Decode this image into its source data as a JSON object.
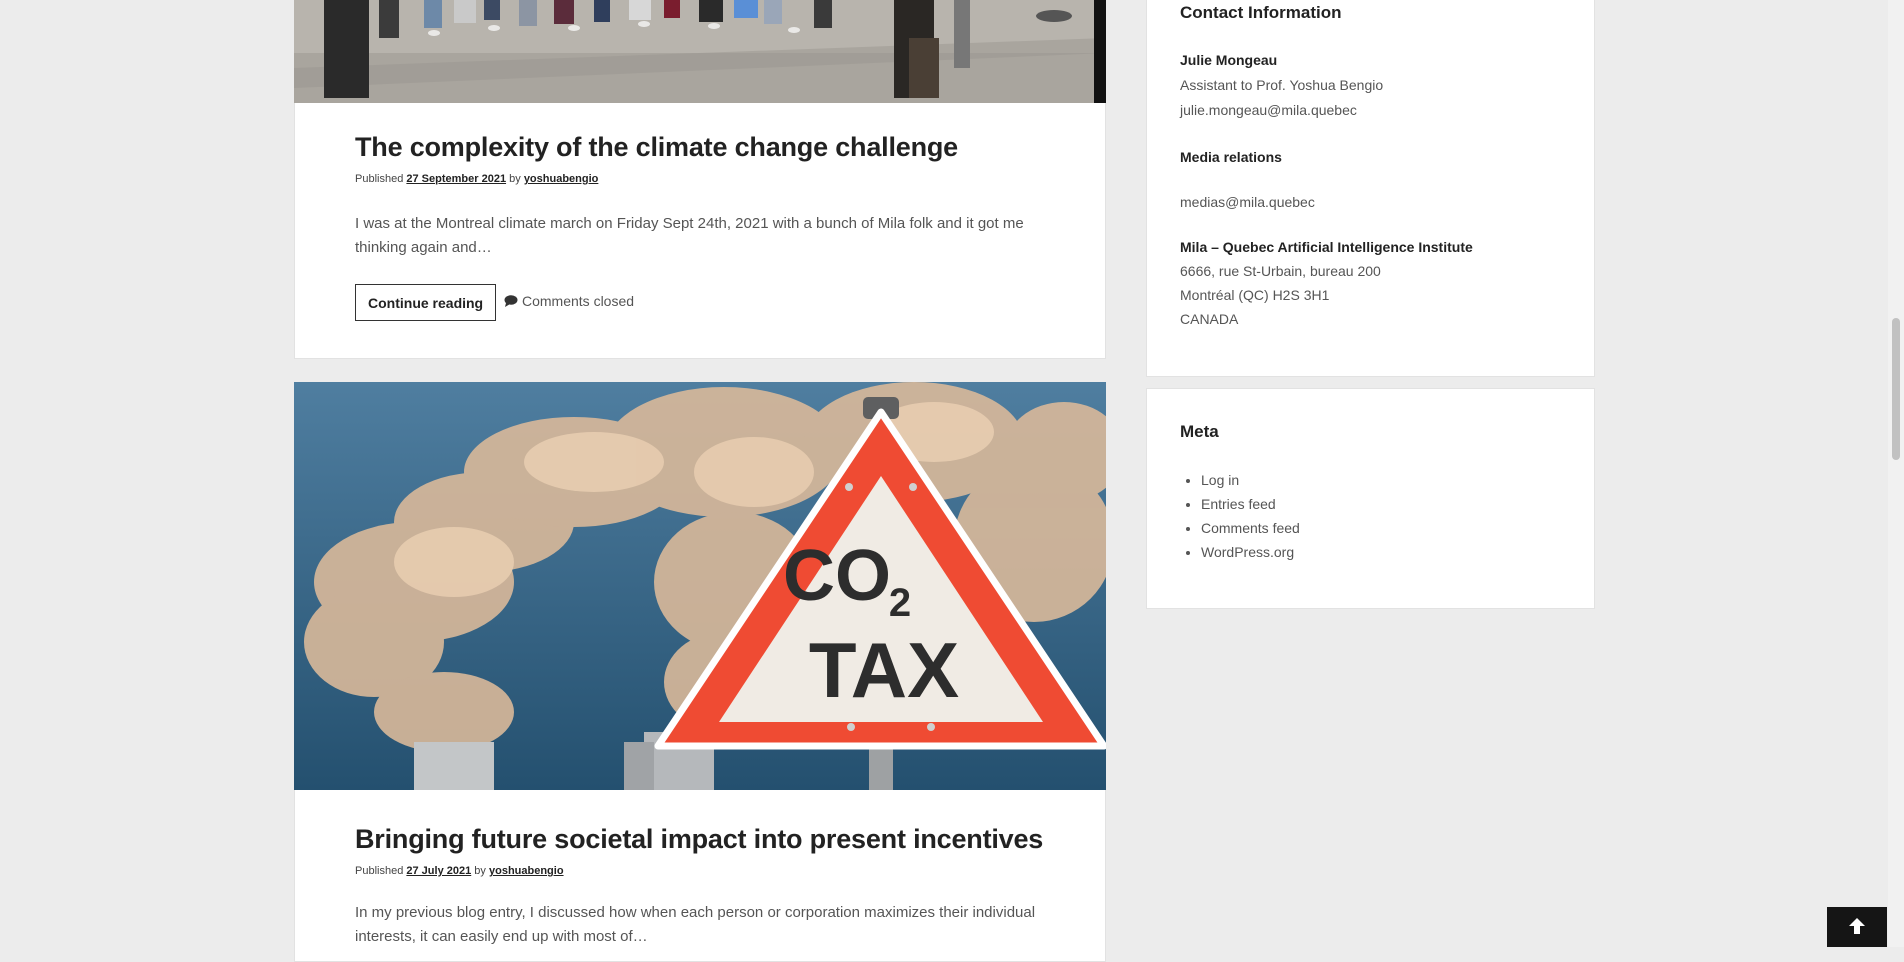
{
  "posts": [
    {
      "title": "The complexity of the climate change challenge",
      "published_label": "Published",
      "date": "27 September 2021",
      "by_label": "by",
      "author": "yoshuabengio",
      "excerpt": "I was at the Montreal climate march on Friday Sept 24th, 2021 with a bunch of Mila folk and it got me thinking again and…",
      "continue_label": "Continue reading",
      "comments_label": "Comments closed"
    },
    {
      "title": "Bringing future societal impact into present incentives",
      "published_label": "Published",
      "date": "27 July 2021",
      "by_label": "by",
      "author": "yoshuabengio",
      "excerpt": "In my previous blog entry, I discussed how when each person or corporation maximizes their individual interests, it can easily end up with most of…",
      "image_sign_line1": "CO",
      "image_sign_sub": "2",
      "image_sign_line2": "TAX"
    }
  ],
  "sidebar": {
    "contact": {
      "title": "Contact Information",
      "name": "Julie Mongeau",
      "role": "Assistant to Prof. Yoshua Bengio",
      "email": "julie.mongeau@mila.quebec",
      "media_title": "Media relations",
      "media_email": "medias@mila.quebec",
      "org": "Mila – Quebec Artificial Intelligence Institute",
      "address1": "6666, rue St-Urbain, bureau 200",
      "address2": "Montréal (QC) H2S 3H1",
      "country": "CANADA"
    },
    "meta": {
      "title": "Meta",
      "links": [
        "Log in",
        "Entries feed",
        "Comments feed",
        "WordPress.org"
      ]
    }
  },
  "icons": {
    "comment": "speech-bubble-icon",
    "back_to_top": "arrow-up-icon"
  },
  "colors": {
    "background": "#ececec",
    "card": "#ffffff",
    "sign_red": "#ef4b33",
    "back_to_top_bg": "#151515"
  }
}
